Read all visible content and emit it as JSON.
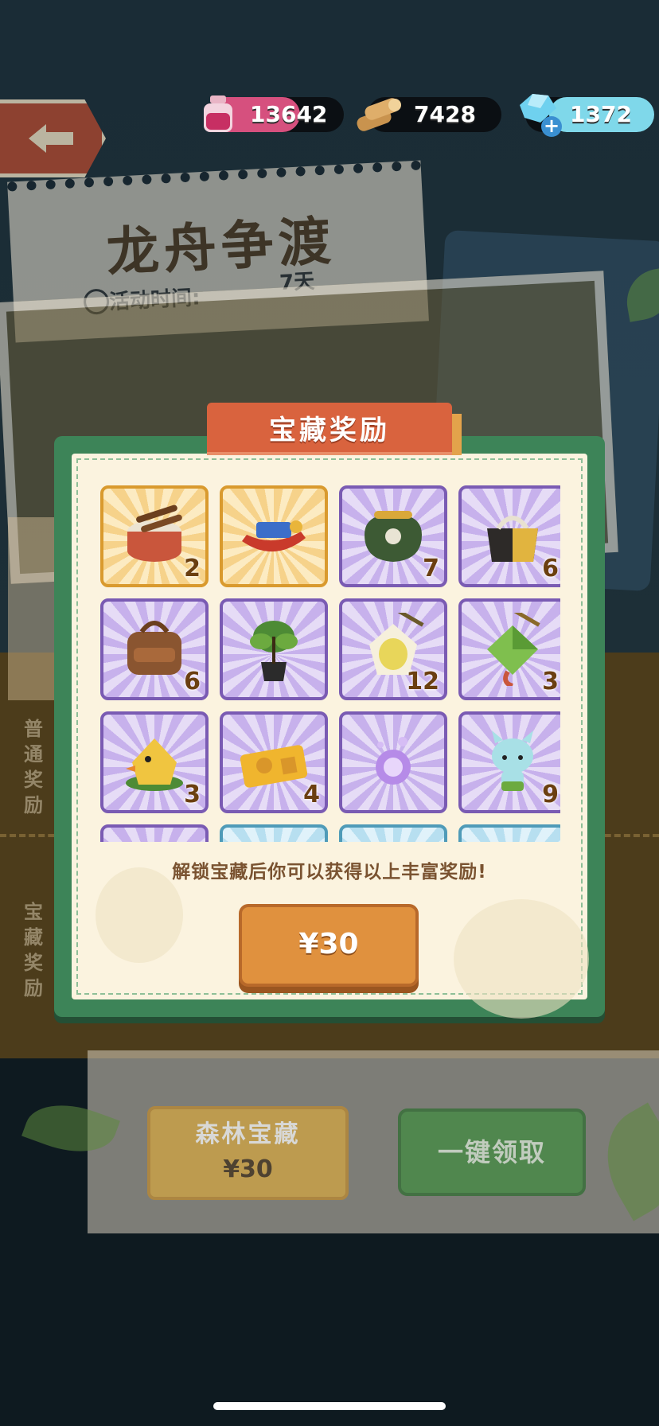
{
  "resources": {
    "potion": "13642",
    "wood": "7428",
    "gems": "1372"
  },
  "event": {
    "title": "龙舟争渡",
    "time_label": "活动时间:",
    "time_value": "7天"
  },
  "side_labels": {
    "normal": "普通奖励",
    "treasure": "宝藏奖励"
  },
  "bottom": {
    "forest_name": "森林宝藏",
    "forest_price": "¥30",
    "claim_all": "一键领取"
  },
  "modal": {
    "title": "宝藏奖励",
    "hint": "解锁宝藏后你可以获得以上丰富奖励!",
    "price_button": "¥30",
    "items": [
      {
        "name": "drum-icon",
        "count": "2",
        "rarity": "gold"
      },
      {
        "name": "dragon-boat-icon",
        "count": "",
        "rarity": "gold"
      },
      {
        "name": "coin-purse-icon",
        "count": "7",
        "rarity": "purple"
      },
      {
        "name": "handbag-icon",
        "count": "6",
        "rarity": "purple"
      },
      {
        "name": "backpack-icon",
        "count": "6",
        "rarity": "purple"
      },
      {
        "name": "potted-plant-icon",
        "count": "",
        "rarity": "purple"
      },
      {
        "name": "salted-egg-icon",
        "count": "12",
        "rarity": "purple"
      },
      {
        "name": "zongzi-icon",
        "count": "3",
        "rarity": "purple"
      },
      {
        "name": "chick-zongzi-icon",
        "count": "3",
        "rarity": "purple"
      },
      {
        "name": "ticket-icon",
        "count": "4",
        "rarity": "purple"
      },
      {
        "name": "magic-orb-icon",
        "count": "",
        "rarity": "purple"
      },
      {
        "name": "blue-pet-icon",
        "count": "9",
        "rarity": "purple"
      },
      {
        "name": "partial-item-icon",
        "count": "",
        "rarity": "purple"
      },
      {
        "name": "partial-item-icon",
        "count": "",
        "rarity": "blue"
      },
      {
        "name": "partial-item-icon",
        "count": "",
        "rarity": "blue"
      },
      {
        "name": "partial-item-icon",
        "count": "",
        "rarity": "blue"
      }
    ]
  },
  "colors": {
    "modal_frame": "#3d8458",
    "modal_header": "#d9633e",
    "price_button": "#e0913e",
    "claim_button": "#3d8c3e"
  }
}
